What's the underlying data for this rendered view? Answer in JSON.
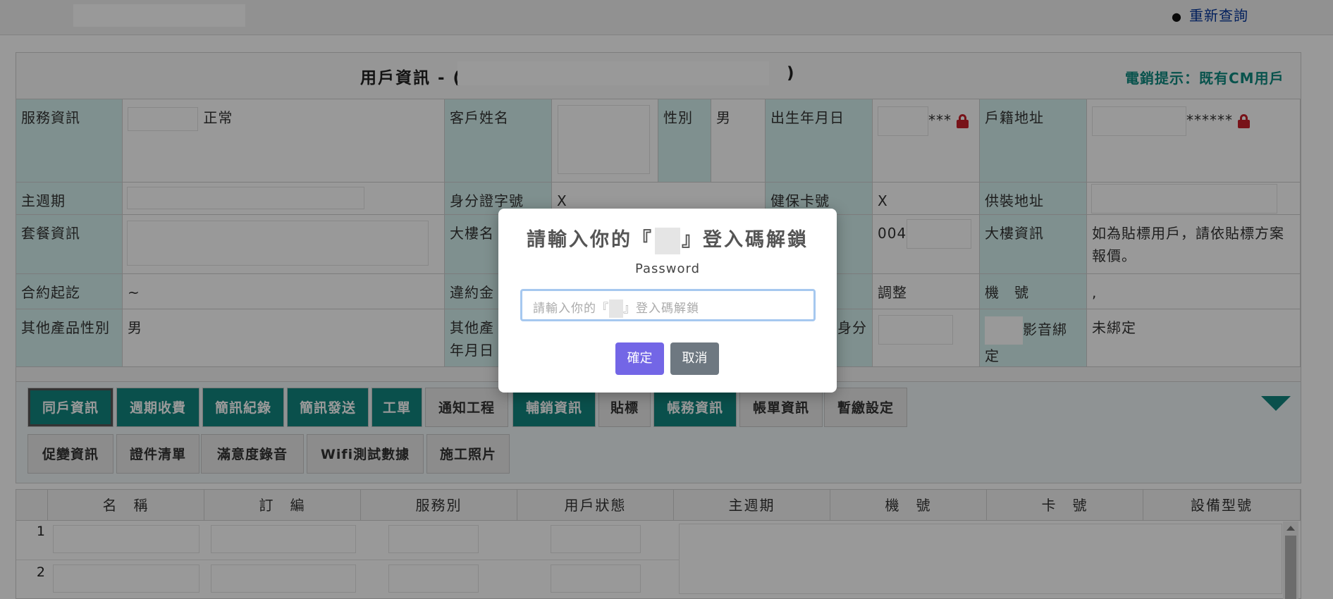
{
  "topbar": {
    "reset_link": "重新查詢"
  },
  "panel": {
    "title": "用戶資訊 - (",
    "title_close": ")",
    "sales_hint": "電銷提示：既有CM用戶"
  },
  "info": {
    "service_info_label": "服務資訊",
    "service_status": "正常",
    "customer_name_label": "客戶姓名",
    "gender_label": "性別",
    "gender_value": "男",
    "birth_label": "出生年月日",
    "birth_mask": "***",
    "household_addr_label": "戶籍地址",
    "household_mask": "******",
    "main_cycle_label": "主週期",
    "id_label": "身分證字號",
    "id_value": "X",
    "health_card_label": "健保卡號",
    "health_card_value": "X",
    "install_addr_label": "供裝地址",
    "package_label": "套餐資訊",
    "building_name_label": "大樓名",
    "building_no_prefix": "004",
    "building_info_label": "大樓資訊",
    "building_info_value": "如為貼標用戶，請依貼標方案報價。",
    "contract_label": "合約起訖",
    "contract_value": "~",
    "penalty_label": "違約金",
    "adjust_value": "調整",
    "device_no_label": "機　號",
    "device_no_value": ",",
    "other_gender_label": "其他產品性別",
    "other_gender_value": "男",
    "other_birth_label_1": "其他產",
    "other_birth_label_2": "年月日",
    "identity_label_fragment": "身分",
    "av_binding_label_1": "影音綁",
    "av_binding_label_2": "定",
    "av_binding_value": "未綁定"
  },
  "tabs": [
    {
      "label": "同戶資訊",
      "style": "teal",
      "active": true
    },
    {
      "label": "週期收費",
      "style": "teal"
    },
    {
      "label": "簡訊紀錄",
      "style": "teal"
    },
    {
      "label": "簡訊發送",
      "style": "teal"
    },
    {
      "label": "工單",
      "style": "teal"
    },
    {
      "label": "通知工程",
      "style": "gray"
    },
    {
      "label": "輔銷資訊",
      "style": "teal"
    },
    {
      "label": "貼標",
      "style": "gray"
    },
    {
      "label": "帳務資訊",
      "style": "teal"
    },
    {
      "label": "帳單資訊",
      "style": "gray"
    },
    {
      "label": "暫繳設定",
      "style": "gray"
    },
    {
      "label": "促變資訊",
      "style": "gray"
    },
    {
      "label": "證件清單",
      "style": "gray"
    },
    {
      "label": "滿意度錄音",
      "style": "gray"
    },
    {
      "label": "Wifi測試數據",
      "style": "gray"
    },
    {
      "label": "施工照片",
      "style": "gray"
    }
  ],
  "grid": {
    "headers": [
      "名　稱",
      "訂　編",
      "服務別",
      "用戶狀態",
      "主週期",
      "機　號",
      "卡　號",
      "設備型號"
    ],
    "rows": [
      "1",
      "2"
    ]
  },
  "modal": {
    "title_prefix": "請輸入你的『",
    "title_suffix": "』登入碼解鎖",
    "label": "Password",
    "placeholder_prefix": "請輸入你的『",
    "placeholder_suffix": "』登入碼解鎖",
    "ok": "確定",
    "cancel": "取消"
  },
  "colors": {
    "teal": "#11867f",
    "confirm": "#7366e6",
    "cancel": "#6e7881",
    "link": "#003399",
    "lock": "#c8202a"
  }
}
